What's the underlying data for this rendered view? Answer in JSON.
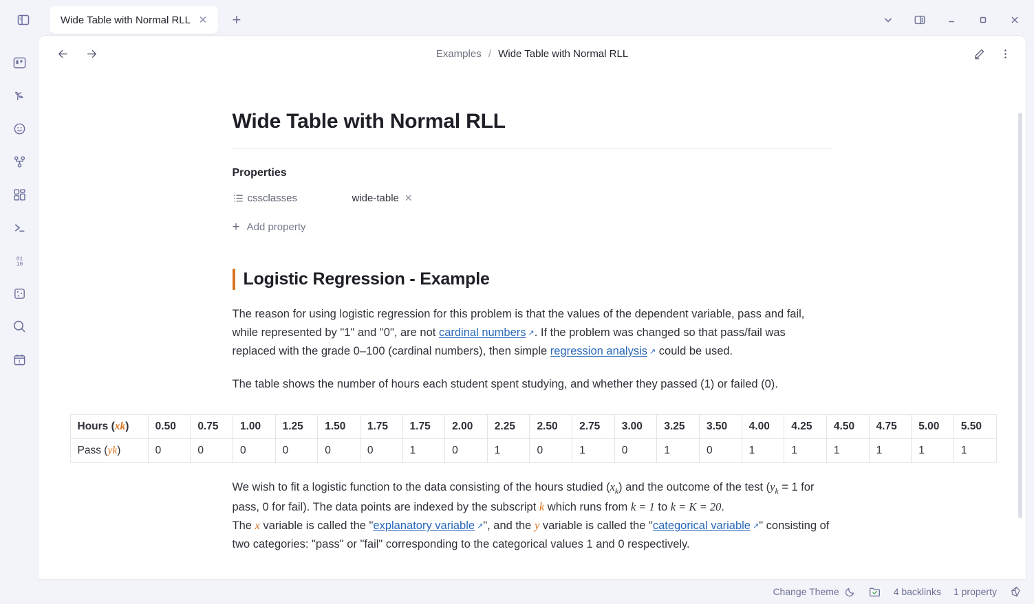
{
  "window": {
    "sidebar_toggle_icon": "panel-left-icon",
    "tab": {
      "title": "Wide Table with Normal RLL",
      "close_icon": "close-icon"
    },
    "new_tab_icon": "plus-icon",
    "controls": {
      "chevron_icon": "chevron-down-icon",
      "right_panel_icon": "panel-right-icon",
      "minimize_icon": "minimize-icon",
      "maximize_icon": "maximize-icon",
      "close_icon": "close-icon"
    }
  },
  "rail": {
    "items": [
      {
        "icon": "kanban-board-icon",
        "label": "Kanban"
      },
      {
        "icon": "sprout-icon",
        "label": "Growth"
      },
      {
        "icon": "smiley-face-icon",
        "label": "Emoji"
      },
      {
        "icon": "graph-nodes-icon",
        "label": "Graph"
      },
      {
        "icon": "dashboard-grid-icon",
        "label": "Dashboard"
      },
      {
        "icon": "terminal-icon",
        "label": "Terminal"
      },
      {
        "icon": "binary-icon",
        "label": "Binary"
      },
      {
        "icon": "dice-icon",
        "label": "Random"
      },
      {
        "icon": "search-icon",
        "label": "Search"
      },
      {
        "icon": "calendar-icon",
        "label": "Calendar"
      }
    ]
  },
  "pane": {
    "back_icon": "arrow-left-icon",
    "forward_icon": "arrow-right-icon",
    "breadcrumb": {
      "parent": "Examples",
      "separator": "/",
      "current": "Wide Table with Normal RLL"
    },
    "edit_icon": "pencil-icon",
    "more_icon": "more-vertical-icon"
  },
  "document": {
    "title": "Wide Table with Normal RLL",
    "properties": {
      "heading": "Properties",
      "rows": [
        {
          "icon": "list-icon",
          "key": "cssclasses",
          "value": "wide-table",
          "remove_icon": "close-icon"
        }
      ],
      "add_label": "Add property",
      "add_icon": "plus-icon"
    },
    "section_heading": "Logistic Regression - Example",
    "paragraph1": {
      "part1": "The reason for using logistic regression for this problem is that the values of the dependent variable, pass and fail, while represented by \"1\" and \"0\", are not ",
      "link1": "cardinal numbers",
      "part2": ". If the problem was changed so that pass/fail was replaced with the grade 0–100 (cardinal numbers), then simple ",
      "link2": "regression analysis",
      "part3": " could be used."
    },
    "paragraph2": "The table shows the number of hours each student spent studying, and whether they passed (1) or failed (0).",
    "paragraph3": {
      "part1": "We wish to fit a logistic function to the data consisting of the hours studied (",
      "math1": "x",
      "math1_sub": "k",
      "part2": ") and the outcome of the test (",
      "math2": "y",
      "math2_sub": "k",
      "part3": " = 1 for pass, 0 for fail). The data points are indexed by the subscript ",
      "math3": "k",
      "part4": " which runs from ",
      "math4": "k = 1",
      "part5": " to ",
      "math5": "k = K = 20",
      "part6": "."
    },
    "paragraph4": {
      "part1": "The ",
      "math1": "x",
      "part2": " variable is called the \"",
      "link1": "explanatory variable",
      "part3": "\", and the ",
      "math2": "y",
      "part4": " variable is called the \"",
      "link2": "categorical variable",
      "part5": "\" consisting of two categories: \"pass\" or \"fail\" corresponding to the categorical values 1 and 0 respectively."
    },
    "table": {
      "row_labels": [
        {
          "text": "Hours (",
          "var": "xk",
          "tail": ")"
        },
        {
          "text": "Pass (",
          "var": "yk",
          "tail": ")"
        }
      ],
      "hours": [
        "0.50",
        "0.75",
        "1.00",
        "1.25",
        "1.50",
        "1.75",
        "1.75",
        "2.00",
        "2.25",
        "2.50",
        "2.75",
        "3.00",
        "3.25",
        "3.50",
        "4.00",
        "4.25",
        "4.50",
        "4.75",
        "5.00",
        "5.50"
      ],
      "pass": [
        "0",
        "0",
        "0",
        "0",
        "0",
        "0",
        "1",
        "0",
        "1",
        "0",
        "1",
        "0",
        "1",
        "0",
        "1",
        "1",
        "1",
        "1",
        "1",
        "1"
      ]
    }
  },
  "statusbar": {
    "change_theme": "Change Theme",
    "moon_icon": "moon-icon",
    "folder_check_icon": "folder-check-icon",
    "backlinks": "4 backlinks",
    "properties": "1 property",
    "obsidian_icon": "obsidian-logo-icon"
  },
  "colors": {
    "accent_orange": "#d9741e",
    "link_blue": "#2968b8",
    "chrome_bg": "#f3f4f9",
    "rail_icon": "#6b6f9e"
  }
}
